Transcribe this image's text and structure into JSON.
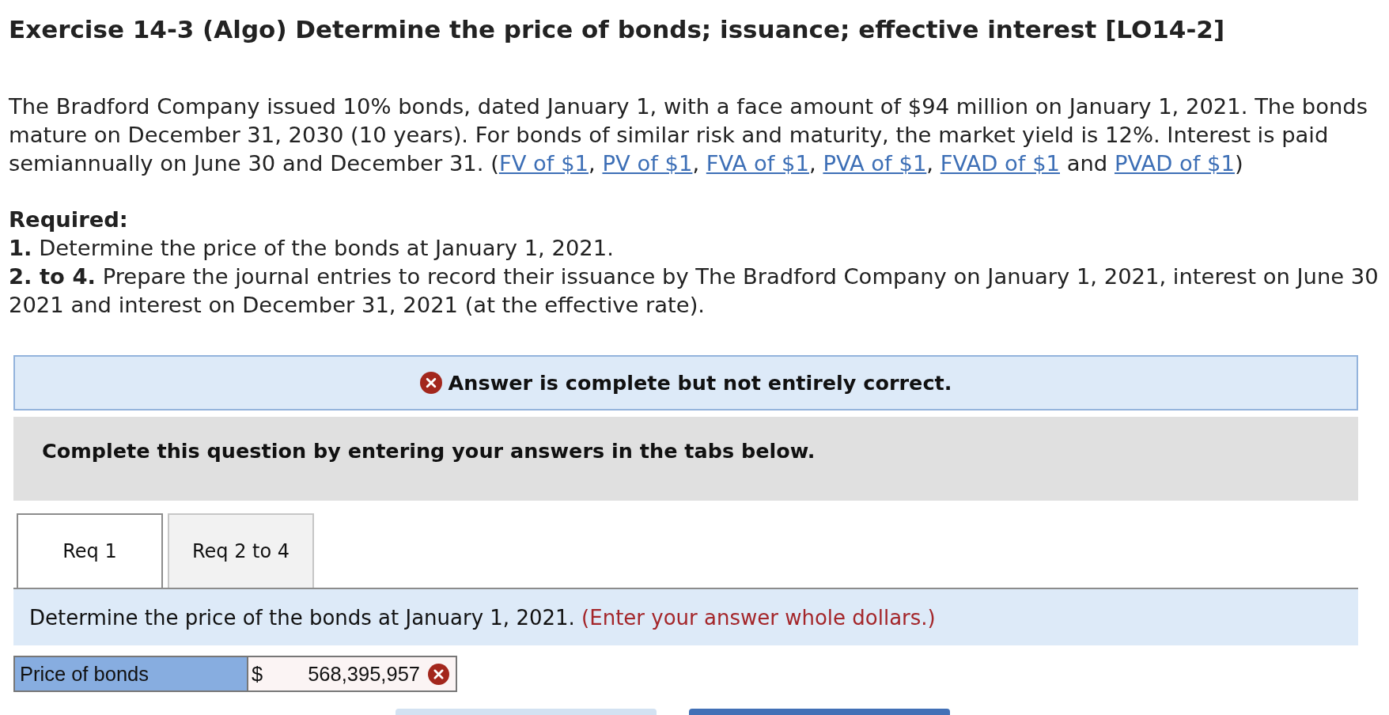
{
  "exercise": {
    "title": "Exercise 14-3 (Algo) Determine the price of bonds; issuance; effective interest [LO14-2]"
  },
  "intro": {
    "lines": [
      [
        {
          "kind": "text",
          "text": "The Bradford Company issued 10% bonds, dated January 1, with a face amount of $94 million on January 1, 2021. The bonds"
        }
      ],
      [
        {
          "kind": "text",
          "text": "mature on December 31, 2030 (10 years). For bonds of similar risk and maturity, the market yield is 12%. Interest is paid"
        }
      ],
      [
        {
          "kind": "text",
          "text": "semiannually on June 30 and December 31. ("
        },
        {
          "kind": "link",
          "text": "FV of $1"
        },
        {
          "kind": "text",
          "text": ", "
        },
        {
          "kind": "link",
          "text": "PV of $1"
        },
        {
          "kind": "text",
          "text": ", "
        },
        {
          "kind": "link",
          "text": "FVA of $1"
        },
        {
          "kind": "text",
          "text": ", "
        },
        {
          "kind": "link",
          "text": "PVA of $1"
        },
        {
          "kind": "text",
          "text": ", "
        },
        {
          "kind": "link",
          "text": "FVAD of $1"
        },
        {
          "kind": "text",
          "text": " and "
        },
        {
          "kind": "link",
          "text": "PVAD of $1"
        },
        {
          "kind": "text",
          "text": ")"
        }
      ]
    ]
  },
  "required": {
    "heading": "Required:",
    "items": [
      {
        "lines": [
          "**1.** Determine the price of the bonds at January 1, 2021."
        ]
      },
      {
        "lines": [
          "**2. to 4.** Prepare the journal entries to record their issuance by The Bradford Company on January 1, 2021, interest on June 30",
          "2021 and interest on December 31, 2021 (at the effective rate)."
        ]
      }
    ]
  },
  "feedback": {
    "correct": false,
    "message": "Answer is complete but not entirely correct."
  },
  "instruction": "Complete this question by entering your answers in the tabs below.",
  "tabs": [
    {
      "label": "Req 1",
      "selected": true
    },
    {
      "label": "Req 2 to 4",
      "selected": false
    }
  ],
  "prompt": {
    "text": "Determine the price of the bonds at January 1, 2021.",
    "hint": "(Enter your answer whole dollars.)"
  },
  "answers": [
    {
      "label": "Price of bonds",
      "currency": "$",
      "value": "568,395,957",
      "correct": false
    }
  ],
  "bottom_buttons": [
    {
      "kind": "secondary"
    },
    {
      "kind": "primary"
    }
  ]
}
